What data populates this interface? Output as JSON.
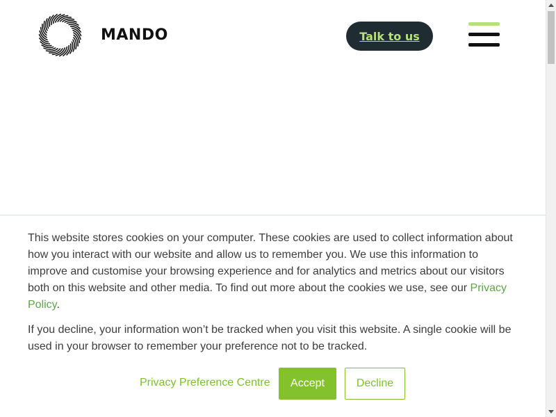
{
  "header": {
    "logo_text": "MANDO",
    "logo_icon": "mando-swirl-logo",
    "cta_label": "Talk to us",
    "menu_icon": "hamburger-menu-icon"
  },
  "cookie_banner": {
    "paragraph1_text": "This website stores cookies on your computer. These cookies are used to collect information about how you interact with our website and allow us to remember you. We use this information to improve and customise your browsing experience and for analytics and metrics about our visitors both on this website and other media. To find out more about the cookies we use, see our ",
    "privacy_link": "Privacy Policy",
    "paragraph1_end": ".",
    "paragraph2_text": "If you decline, your information won’t be tracked when you visit this website. A single cookie will be used in your browser to remember your preference not to be tracked.",
    "preference_link": "Privacy Preference Centre",
    "accept_label": "Accept",
    "decline_label": "Decline"
  },
  "colors": {
    "accent_green": "#84c22d",
    "cta_background": "#1f2d33",
    "cta_text": "#b6e07a",
    "text": "#3c3c3c"
  }
}
